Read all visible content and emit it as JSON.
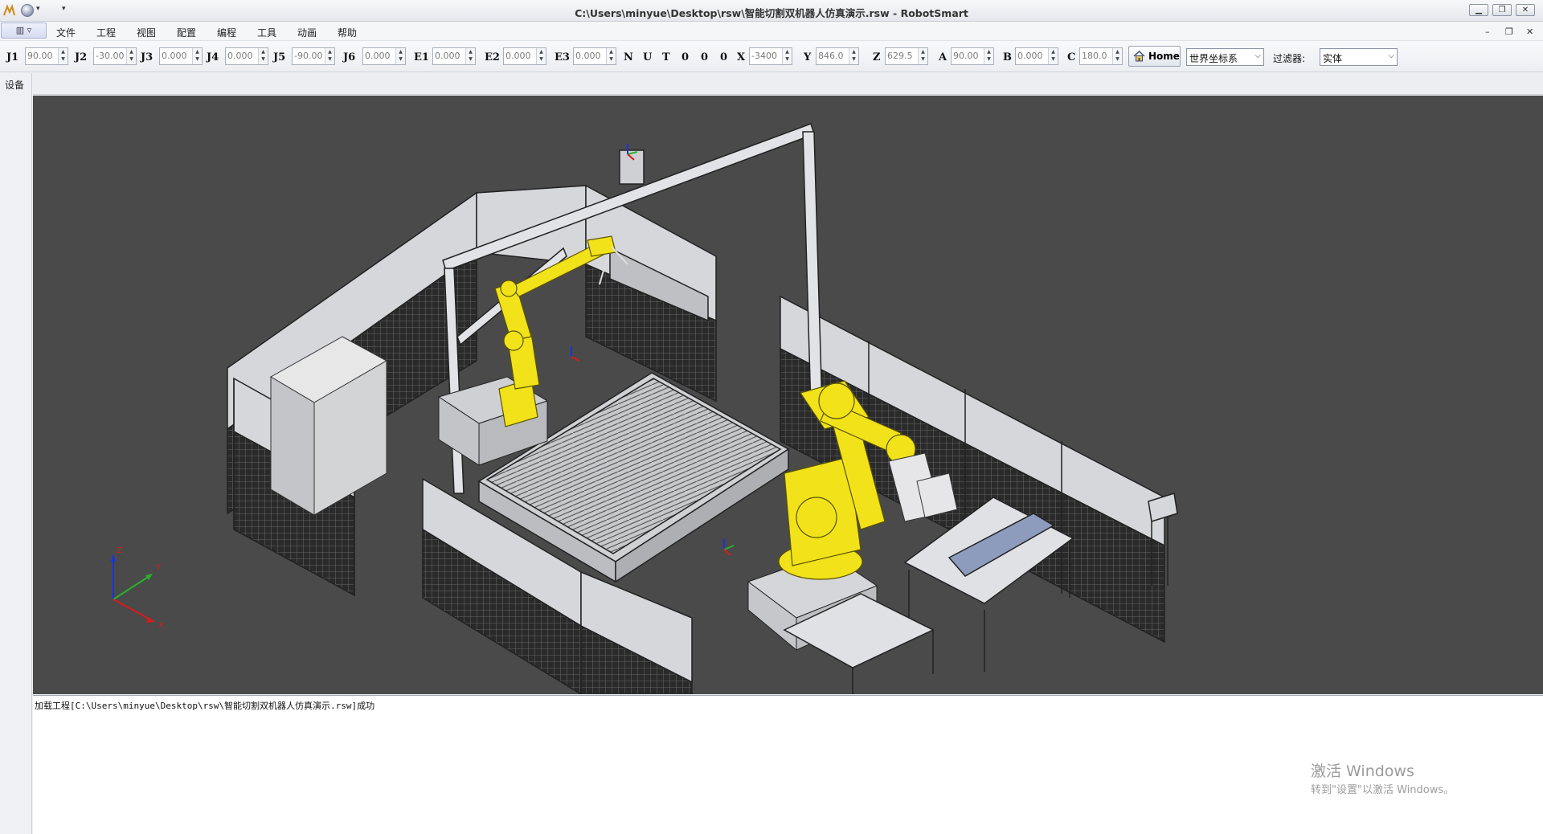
{
  "window": {
    "title": "C:\\Users\\minyue\\Desktop\\rsw\\智能切割双机器人仿真演示.rsw - RobotSmart",
    "minimize": "▁",
    "restore": "❐",
    "close": "✕"
  },
  "menu": {
    "items": [
      "文件",
      "工程",
      "视图",
      "配置",
      "编程",
      "工具",
      "动画",
      "帮助"
    ],
    "mdi_minimize": "–",
    "mdi_restore": "❐",
    "mdi_close": "✕"
  },
  "toolbar": {
    "fields": [
      {
        "label": "J1",
        "value": "90.00"
      },
      {
        "label": "J2",
        "value": "-30.00"
      },
      {
        "label": "J3",
        "value": "0.000"
      },
      {
        "label": "J4",
        "value": "0.000"
      },
      {
        "label": "J5",
        "value": "-90.00"
      },
      {
        "label": "J6",
        "value": "0.000"
      },
      {
        "label": "E1",
        "value": "0.000"
      },
      {
        "label": "E2",
        "value": "0.000"
      },
      {
        "label": "E3",
        "value": "0.000"
      }
    ],
    "config_letters": [
      "N",
      "U",
      "T",
      "0",
      "0",
      "0"
    ],
    "cart_fields": [
      {
        "label": "X",
        "value": "-3400"
      },
      {
        "label": "Y",
        "value": "846.0"
      },
      {
        "label": "Z",
        "value": "629.5"
      },
      {
        "label": "A",
        "value": "90.00"
      },
      {
        "label": "B",
        "value": "0.000"
      },
      {
        "label": "C",
        "value": "180.0"
      }
    ],
    "home_label": "Home",
    "coord_system": "世界坐标系",
    "filter_label": "过滤器:",
    "filter_value": "实体"
  },
  "sidebar": {
    "tab_label": "设备"
  },
  "viewport": {
    "axis_labels": {
      "x": "X",
      "y": "Y",
      "z": "Z"
    }
  },
  "log": {
    "lines": [
      "加载工程[C:\\Users\\minyue\\Desktop\\rsw\\智能切割双机器人仿真演示.rsw]成功"
    ]
  },
  "watermark": {
    "title": "激活 Windows",
    "subtitle": "转到\"设置\"以激活 Windows。"
  },
  "colors": {
    "viewport_bg": "#4a4a4a",
    "robot_yellow": "#f2e21a",
    "fence_gray": "#d9dadd",
    "mesh_dark": "#2b2b2b"
  }
}
